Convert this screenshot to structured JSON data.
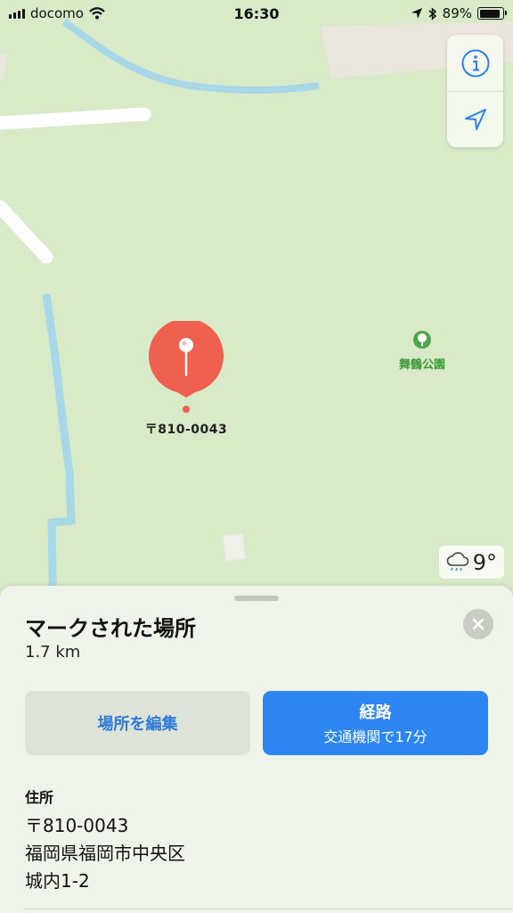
{
  "status_bar": {
    "carrier": "docomo",
    "time": "16:30",
    "battery_percent": "89%",
    "battery_level": 0.89,
    "icons": [
      "signal-icon",
      "wifi-icon",
      "location-arrow-icon",
      "bluetooth-icon",
      "battery-icon"
    ]
  },
  "map": {
    "pin_label": "〒810-0043",
    "park_label": "舞鶴公園",
    "weather_temp": "9°",
    "colors": {
      "land": "#d8eac8",
      "water": "#a8d8e8",
      "road": "#ffffff",
      "pin": "#f0604f",
      "park_text": "#3f9a3a"
    }
  },
  "sheet": {
    "title": "マークされた場所",
    "distance": "1.7 km",
    "edit_button": "場所を編集",
    "route_button": {
      "label": "経路",
      "sub": "交通機関で17分"
    },
    "address": {
      "label": "住所",
      "lines": [
        "〒810-0043",
        "福岡県福岡市中央区",
        "城内1-2"
      ]
    },
    "colors": {
      "accent": "#2d86f2",
      "sheet_bg": "#eef4e9"
    }
  }
}
